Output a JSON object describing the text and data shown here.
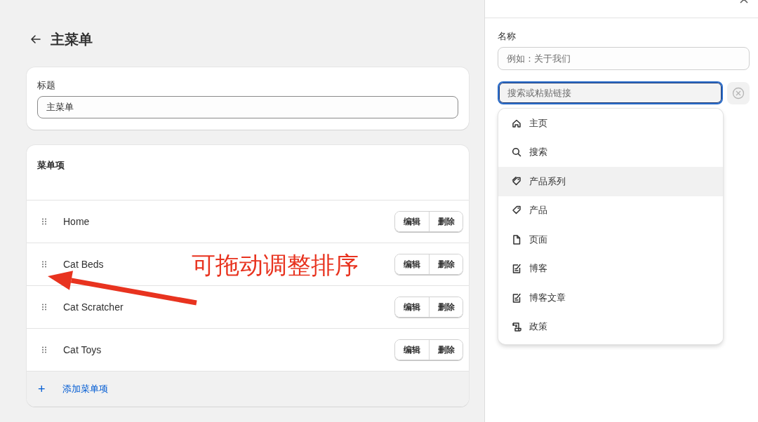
{
  "page": {
    "title": "主菜单"
  },
  "title_card": {
    "label": "标题",
    "value": "主菜单"
  },
  "menu_card": {
    "heading": "菜单项",
    "items": [
      {
        "label": "Home",
        "edit": "编辑",
        "delete": "删除"
      },
      {
        "label": "Cat Beds",
        "edit": "编辑",
        "delete": "删除"
      },
      {
        "label": "Cat Scratcher",
        "edit": "编辑",
        "delete": "删除"
      },
      {
        "label": "Cat Toys",
        "edit": "编辑",
        "delete": "删除"
      }
    ],
    "add_item": {
      "icon": "+",
      "label": "添加菜单项"
    }
  },
  "add_panel": {
    "name_label": "名称",
    "name_field": {
      "placeholder": "例如：关于我们"
    },
    "link_field": {
      "placeholder": "搜索或粘贴链接",
      "focused": true
    },
    "options": [
      {
        "kind": "home",
        "label": "主页",
        "selected": false
      },
      {
        "kind": "search",
        "label": "搜索",
        "selected": false
      },
      {
        "kind": "collection",
        "label": "产品系列",
        "selected": true
      },
      {
        "kind": "product",
        "label": "产品",
        "selected": false
      },
      {
        "kind": "page",
        "label": "页面",
        "selected": false
      },
      {
        "kind": "blog",
        "label": "博客",
        "selected": false
      },
      {
        "kind": "article",
        "label": "博客文章",
        "selected": false
      },
      {
        "kind": "policy",
        "label": "政策",
        "selected": false
      }
    ]
  },
  "annotation": {
    "text": "可拖动调整排序"
  }
}
